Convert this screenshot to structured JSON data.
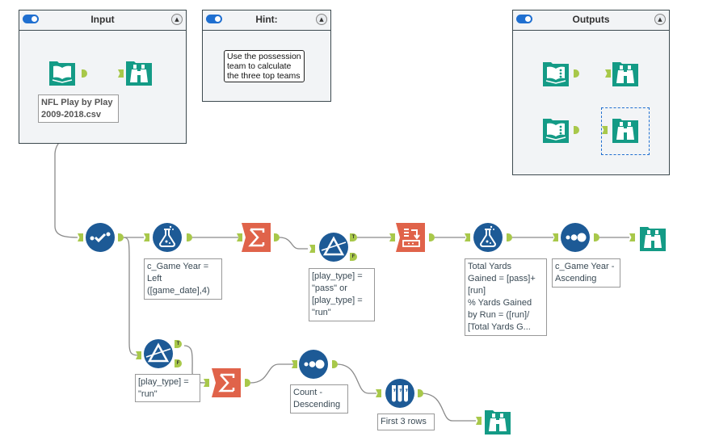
{
  "containers": {
    "input": {
      "title": "Input",
      "enabled": true,
      "collapse_icon": "collapse-up-icon"
    },
    "hint": {
      "title": "Hint:",
      "enabled": true,
      "collapse_icon": "collapse-up-icon",
      "text": "Use the possession\nteam to calculate\nthe three top teams"
    },
    "outputs": {
      "title": "Outputs",
      "enabled": true,
      "collapse_icon": "collapse-up-icon"
    }
  },
  "tools": {
    "input_data": {
      "icon": "book-input-icon",
      "annotation": "NFL Play by Play\n2009-2018.csv"
    },
    "browse_input": {
      "icon": "binoculars-browse-icon"
    },
    "out_macro_1": {
      "icon": "macro-output-icon"
    },
    "browse_out_1": {
      "icon": "binoculars-browse-icon"
    },
    "out_macro_2": {
      "icon": "macro-output-icon"
    },
    "browse_out_2": {
      "icon": "binoculars-browse-icon",
      "selected": true
    },
    "select": {
      "icon": "select-check-icon"
    },
    "formula_1": {
      "icon": "formula-flask-icon",
      "annotation": "c_Game Year =\nLeft\n([game_date],4)"
    },
    "summarize_1": {
      "icon": "summarize-sigma-icon"
    },
    "filter_1": {
      "icon": "filter-prism-icon",
      "annotation": "[play_type] =\n\"pass\" or\n[play_type] =\n\"run\""
    },
    "crosstab": {
      "icon": "crosstab-icon"
    },
    "formula_2": {
      "icon": "formula-flask-icon",
      "annotation": "Total Yards\nGained = [pass]+\n[run]\n%  Yards Gained\nby Run = ([run]/\n[Total Yards G..."
    },
    "sort_1": {
      "icon": "sort-dots-icon",
      "annotation": "c_Game Year -\nAscending"
    },
    "browse_main": {
      "icon": "binoculars-browse-icon"
    },
    "filter_2": {
      "icon": "filter-prism-icon",
      "annotation": "[play_type] =\n\"run\""
    },
    "summarize_2": {
      "icon": "summarize-sigma-icon"
    },
    "sort_2": {
      "icon": "sort-dots-icon",
      "annotation": "Count -\nDescending"
    },
    "sample": {
      "icon": "sample-tubes-icon",
      "annotation": "First 3 rows"
    },
    "browse_bottom": {
      "icon": "binoculars-browse-icon"
    }
  },
  "anchor_labels": {
    "true": "T",
    "false": "F"
  },
  "colors": {
    "in_out_tool": "#149b86",
    "preparation_tool": "#1d5a96",
    "transform_tool": "#e0634a",
    "anchor": "#a8c84a",
    "selected_connection": "#5b5fe0",
    "toggle": "#1f6fd0"
  }
}
